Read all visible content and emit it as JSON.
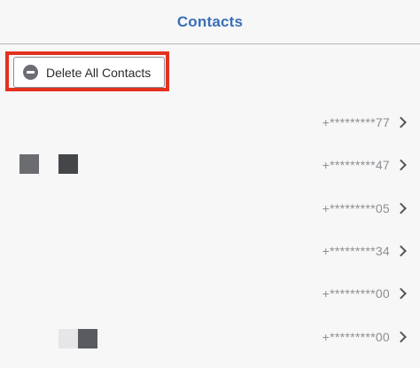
{
  "header": {
    "title": "Contacts"
  },
  "toolbar": {
    "delete_all_label": "Delete All Contacts",
    "delete_icon": "minus-circle-icon"
  },
  "contacts": [
    {
      "number": "+*********77"
    },
    {
      "number": "+*********47"
    },
    {
      "number": "+*********05"
    },
    {
      "number": "+*********34"
    },
    {
      "number": "+*********00"
    },
    {
      "number": "+*********00"
    }
  ],
  "colors": {
    "accent": "#3b6fb5",
    "highlight": "#e3311f",
    "background": "#f7f7f8"
  }
}
